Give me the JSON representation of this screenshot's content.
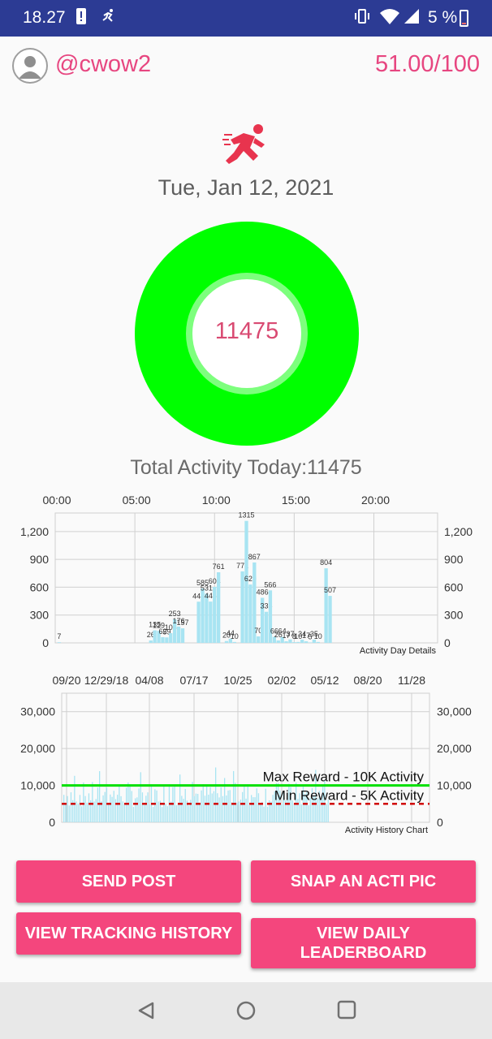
{
  "status_bar": {
    "time": "18.27",
    "battery_text": "5 %",
    "icons": [
      "alert-icon",
      "running-notification-icon",
      "vibrate-icon",
      "wifi-icon",
      "signal-icon",
      "battery-icon"
    ]
  },
  "header": {
    "username": "@cwow2",
    "score": "51.00/100"
  },
  "main": {
    "date": "Tue, Jan 12, 2021",
    "activity_value": "11475",
    "total_label": "Total Activity Today:11475",
    "colors": {
      "ring": "#00ff00",
      "accent": "#e74680",
      "button": "#f4467d",
      "bars": "#a8e4f2"
    }
  },
  "buttons": {
    "send_post": "SEND POST",
    "snap_pic": "SNAP AN ACTI PIC",
    "view_tracking": "VIEW TRACKING HISTORY",
    "view_leaderboard": "VIEW DAILY LEADERBOARD"
  },
  "chart_data": [
    {
      "type": "bar",
      "description_label": "Activity Day Details",
      "x_tick_labels": [
        "00:00",
        "05:00",
        "10:00",
        "15:00",
        "20:00"
      ],
      "x_range": [
        0,
        24
      ],
      "y_ticks": [
        "0",
        "300",
        "600",
        "900",
        "1,200"
      ],
      "ylim": [
        0,
        1400
      ],
      "grid": true,
      "data": [
        {
          "x": 0.25,
          "y": 7
        },
        {
          "x": 6.0,
          "y": 26
        },
        {
          "x": 6.25,
          "y": 135
        },
        {
          "x": 6.5,
          "y": 129
        },
        {
          "x": 6.75,
          "y": 62
        },
        {
          "x": 7.0,
          "y": 59
        },
        {
          "x": 7.25,
          "y": 105
        },
        {
          "x": 7.5,
          "y": 253
        },
        {
          "x": 7.75,
          "y": 176
        },
        {
          "x": 8.0,
          "y": 157
        },
        {
          "x": 9.0,
          "y": 444
        },
        {
          "x": 9.25,
          "y": 585
        },
        {
          "x": 9.5,
          "y": 531
        },
        {
          "x": 9.75,
          "y": 445
        },
        {
          "x": 10.0,
          "y": 604
        },
        {
          "x": 10.25,
          "y": 761
        },
        {
          "x": 10.75,
          "y": 20
        },
        {
          "x": 11.0,
          "y": 44
        },
        {
          "x": 11.25,
          "y": 10
        },
        {
          "x": 11.75,
          "y": 771
        },
        {
          "x": 12.0,
          "y": 1315
        },
        {
          "x": 12.25,
          "y": 629
        },
        {
          "x": 12.5,
          "y": 867
        },
        {
          "x": 12.75,
          "y": 70
        },
        {
          "x": 13.0,
          "y": 486
        },
        {
          "x": 13.25,
          "y": 335
        },
        {
          "x": 13.5,
          "y": 566
        },
        {
          "x": 13.75,
          "y": 66
        },
        {
          "x": 14.0,
          "y": 26
        },
        {
          "x": 14.25,
          "y": 64
        },
        {
          "x": 14.5,
          "y": 17
        },
        {
          "x": 14.75,
          "y": 37
        },
        {
          "x": 15.0,
          "y": 8
        },
        {
          "x": 15.25,
          "y": 10
        },
        {
          "x": 15.5,
          "y": 34
        },
        {
          "x": 15.75,
          "y": 17
        },
        {
          "x": 16.0,
          "y": 5
        },
        {
          "x": 16.25,
          "y": 35
        },
        {
          "x": 16.5,
          "y": 10
        },
        {
          "x": 17.0,
          "y": 804
        },
        {
          "x": 17.25,
          "y": 507
        }
      ]
    },
    {
      "type": "bar",
      "description_label": "Activity History Chart",
      "x_tick_labels": [
        "09/20",
        "12/29/18",
        "04/08",
        "07/17",
        "10/25",
        "02/02",
        "05/12",
        "08/20",
        "11/28"
      ],
      "y_ticks": [
        "0",
        "10,000",
        "20,000",
        "30,000"
      ],
      "ylim": [
        0,
        30000
      ],
      "grid": true,
      "limit_lines": [
        {
          "label": "Max Reward - 10K Activity",
          "value": 10000,
          "color": "#00e000",
          "style": "solid"
        },
        {
          "label": "Min Reward - 5K Activity",
          "value": 5000,
          "color": "#d00000",
          "style": "dashed"
        }
      ],
      "series_note": "daily activity counts, mostly between 3,000 and 18,000"
    }
  ]
}
